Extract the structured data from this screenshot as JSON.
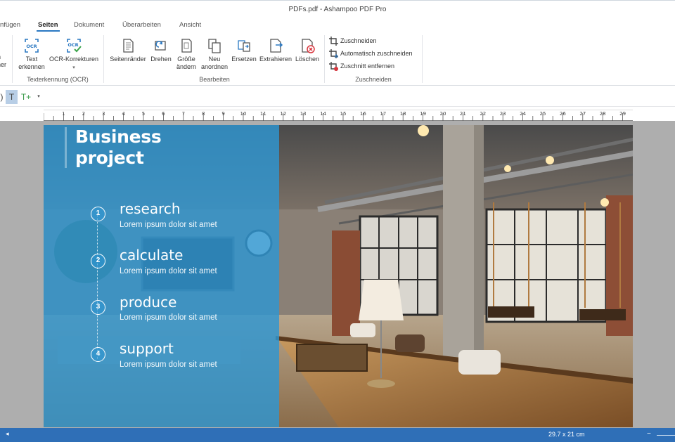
{
  "window": {
    "title": "PDFs.pdf - Ashampoo PDF Pro"
  },
  "tabs": [
    {
      "label": "nfügen"
    },
    {
      "label": "Seiten"
    },
    {
      "label": "Dokument"
    },
    {
      "label": "Überarbeiten"
    },
    {
      "label": "Ansicht"
    }
  ],
  "ribbon": {
    "ocr_group": {
      "partial_label_top": "n",
      "partial_label_bottom": "her",
      "text_recognize": "Text\nerkennen",
      "ocr_corrections": "OCR-Korrekturen",
      "dropdown_marker": "▾",
      "group_label": "Texterkennung (OCR)"
    },
    "edit_group": {
      "buttons": [
        {
          "label": "Seitenränder"
        },
        {
          "label": "Drehen"
        },
        {
          "label": "Größe\nändern"
        },
        {
          "label": "Neu\nanordnen"
        },
        {
          "label": "Ersetzen"
        },
        {
          "label": "Extrahieren"
        },
        {
          "label": "Löschen"
        }
      ],
      "group_label": "Bearbeiten"
    },
    "crop_group": {
      "buttons": [
        {
          "label": "Zuschneiden"
        },
        {
          "label": "Automatisch zuschneiden"
        },
        {
          "label": "Zuschnitt entfernen"
        }
      ],
      "group_label": "Zuschneiden"
    }
  },
  "toolbar2": {
    "items": [
      {
        "label": ")"
      },
      {
        "label": "T"
      },
      {
        "label": "T+"
      },
      {
        "label": "▾"
      }
    ]
  },
  "ruler": {
    "numbers": [
      "1",
      "2",
      "3",
      "4",
      "5",
      "6",
      "7",
      "8",
      "9",
      "10",
      "11",
      "12",
      "13",
      "14",
      "15",
      "16",
      "17",
      "18",
      "19",
      "20",
      "21",
      "22",
      "23",
      "24",
      "25",
      "26",
      "27",
      "28",
      "29"
    ]
  },
  "page_content": {
    "heading_line1": "Business",
    "heading_line2": "project",
    "steps": [
      {
        "num": "1",
        "title": "research",
        "sub": "Lorem ipsum dolor sit amet"
      },
      {
        "num": "2",
        "title": "calculate",
        "sub": "Lorem ipsum dolor sit amet"
      },
      {
        "num": "3",
        "title": "produce",
        "sub": "Lorem ipsum dolor sit amet"
      },
      {
        "num": "4",
        "title": "support",
        "sub": "Lorem ipsum dolor sit amet"
      }
    ]
  },
  "statusbar": {
    "page_size": "29.7 x 21 cm"
  },
  "colors": {
    "accent": "#2a78c2",
    "panel_blue": "#2e96d2",
    "status_bar": "#2f6fb7"
  }
}
